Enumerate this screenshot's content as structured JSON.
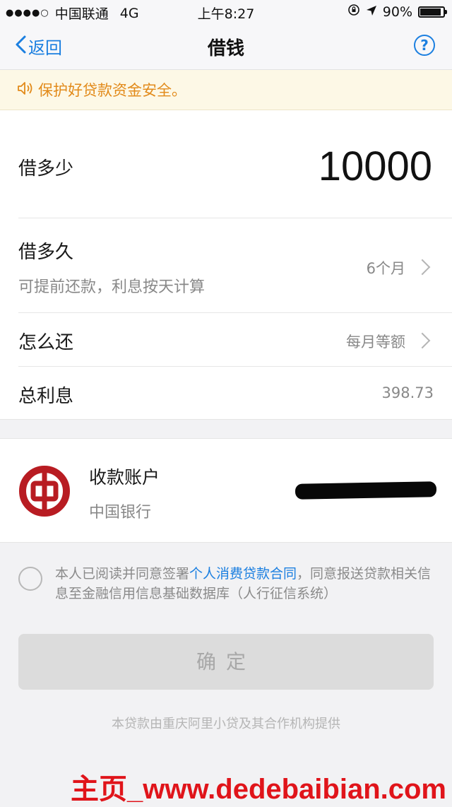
{
  "status_bar": {
    "signal": "●●●●○",
    "carrier": "中国联通",
    "network": "4G",
    "time": "上午8:27",
    "battery_percent": "90%",
    "battery_level": 0.9
  },
  "nav": {
    "back_label": "返回",
    "title": "借钱",
    "help_label": "?"
  },
  "notice": {
    "text": "保护好贷款资金安全。"
  },
  "loan": {
    "amount_label": "借多少",
    "amount_value": "10000",
    "term_label": "借多久",
    "term_sub": "可提前还款，利息按天计算",
    "term_value": "6个月",
    "repay_label": "怎么还",
    "repay_value": "每月等额",
    "interest_label": "总利息",
    "interest_value": "398.73"
  },
  "account": {
    "title": "收款账户",
    "bank": "中国银行",
    "logo_color": "#b81c22"
  },
  "agreement": {
    "text_before": "本人已阅读并同意签署",
    "link": "个人消费贷款合同",
    "text_after": "，同意报送贷款相关信息至金融信用信息基础数据库（人行征信系统）"
  },
  "confirm_label": "确定",
  "footer_note": "本贷款由重庆阿里小贷及其合作机构提供",
  "watermark": "主页_www.dedebaibian.com",
  "colors": {
    "accent": "#1b7fe0",
    "notice": "#e28a1a",
    "watermark": "#e0141a"
  }
}
